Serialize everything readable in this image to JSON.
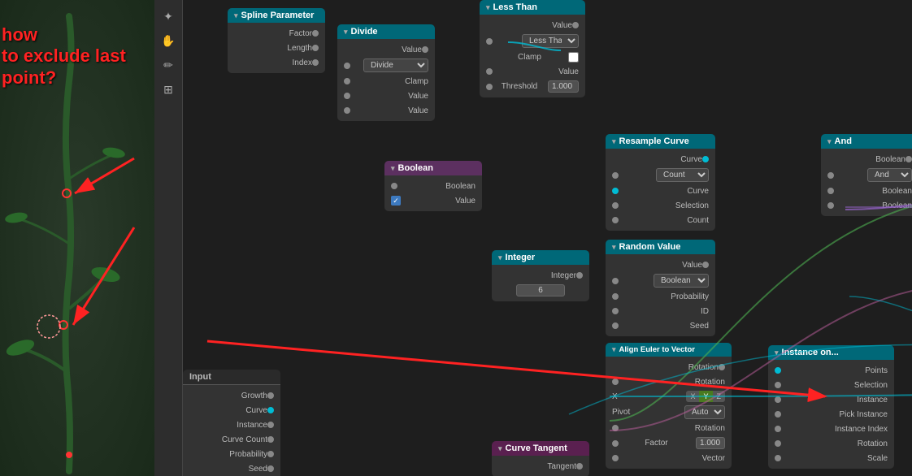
{
  "viewport": {
    "background": "#2a3a2a"
  },
  "question": {
    "line1": "how",
    "line2": "to exclude last point?"
  },
  "toolbar": {
    "icons": [
      "✦",
      "✋",
      "✏",
      "⊞"
    ]
  },
  "nodes": {
    "spline_parameter": {
      "title": "Spline Parameter",
      "color": "teal",
      "outputs": [
        "Factor",
        "Length",
        "Index"
      ]
    },
    "less_than": {
      "title": "Less Than",
      "color": "teal",
      "outputs": [
        "Value"
      ],
      "inputs": [
        "Less Than",
        "Clamp",
        "Value",
        "Threshold"
      ]
    },
    "divide": {
      "title": "Divide",
      "color": "teal",
      "outputs": [
        "Value"
      ],
      "inputs": [
        "Divide",
        "Clamp",
        "Value",
        "Value"
      ]
    },
    "boolean": {
      "title": "Boolean",
      "color": "purple",
      "inputs": [
        "Boolean",
        "Value"
      ]
    },
    "resample_curve": {
      "title": "Resample Curve",
      "color": "teal",
      "inputs": [
        "Curve",
        "Selection",
        "Count"
      ],
      "mode": "Count"
    },
    "and": {
      "title": "And",
      "color": "teal",
      "outputs": [
        "Boolean"
      ],
      "inputs": [
        "And",
        "Boolean",
        "Boolean"
      ]
    },
    "random_value": {
      "title": "Random Value",
      "color": "teal",
      "outputs": [
        "Value"
      ],
      "mode": "Boolean",
      "inputs": [
        "Probability",
        "ID",
        "Seed"
      ]
    },
    "integer": {
      "title": "Integer",
      "color": "teal",
      "value": "6",
      "outputs": [
        "Integer"
      ]
    },
    "align_euler": {
      "title": "Align Euler to Vector",
      "color": "teal",
      "outputs": [
        "Rotation"
      ],
      "inputs": [
        "Rotation",
        "Factor",
        "Vector"
      ]
    },
    "curve_tangent": {
      "title": "Curve Tangent",
      "color": "pink",
      "outputs": [
        "Tangent"
      ]
    },
    "instance_on": {
      "title": "Instance on...",
      "color": "teal",
      "inputs": [
        "Points",
        "Selection",
        "Instance",
        "Pick Instance",
        "Instance Index",
        "Rotation",
        "Scale"
      ]
    },
    "input_node": {
      "title": "Input",
      "inputs": [
        "Growth",
        "Curve",
        "Instance",
        "Curve Count",
        "Probability",
        "Seed"
      ]
    }
  }
}
